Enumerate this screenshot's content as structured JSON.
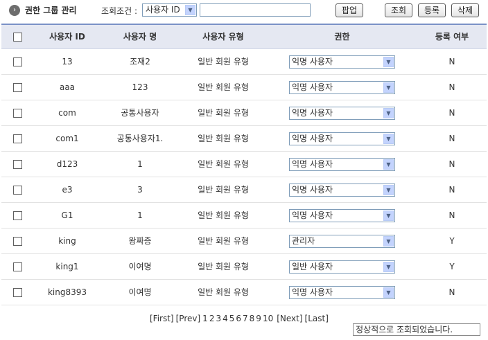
{
  "header": {
    "title": "권한 그룹 관리",
    "condition_label": "조회조건 :",
    "condition_value": "사용자 ID",
    "search_value": "",
    "popup_label": "팝업",
    "search_label": "조회",
    "register_label": "등록",
    "delete_label": "삭제"
  },
  "table": {
    "columns": [
      "사용자 ID",
      "사용자 명",
      "사용자 유형",
      "권한",
      "등록 여부"
    ],
    "rows": [
      {
        "id": "13",
        "name": "조재2",
        "type": "일반 회원 유형",
        "auth": "익명 사용자",
        "registered": "N"
      },
      {
        "id": "aaa",
        "name": "123",
        "type": "일반 회원 유형",
        "auth": "익명 사용자",
        "registered": "N"
      },
      {
        "id": "com",
        "name": "공통사용자",
        "type": "일반 회원 유형",
        "auth": "익명 사용자",
        "registered": "N"
      },
      {
        "id": "com1",
        "name": "공통사용자1.",
        "type": "일반 회원 유형",
        "auth": "익명 사용자",
        "registered": "N"
      },
      {
        "id": "d123",
        "name": "1",
        "type": "일반 회원 유형",
        "auth": "익명 사용자",
        "registered": "N"
      },
      {
        "id": "e3",
        "name": "3",
        "type": "일반 회원 유형",
        "auth": "익명 사용자",
        "registered": "N"
      },
      {
        "id": "G1",
        "name": "1",
        "type": "일반 회원 유형",
        "auth": "익명 사용자",
        "registered": "N"
      },
      {
        "id": "king",
        "name": "왕짜증",
        "type": "일반 회원 유형",
        "auth": "관리자",
        "registered": "Y"
      },
      {
        "id": "king1",
        "name": "이여명",
        "type": "일반 회원 유형",
        "auth": "일반 사용자",
        "registered": "Y"
      },
      {
        "id": "king8393",
        "name": "이여명",
        "type": "일반 회원 유형",
        "auth": "익명 사용자",
        "registered": "N"
      }
    ]
  },
  "pagination": {
    "first": "[First]",
    "prev": "[Prev]",
    "pages": [
      "1",
      "2",
      "3",
      "4",
      "5",
      "6",
      "7",
      "8",
      "9",
      "10"
    ],
    "next": "[Next]",
    "last": "[Last]"
  },
  "status_message": "정상적으로 조회되었습니다."
}
